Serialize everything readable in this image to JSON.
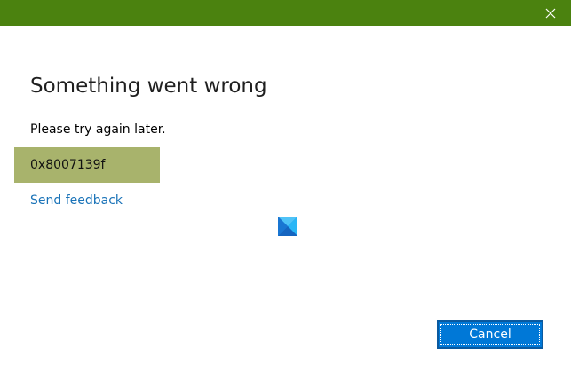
{
  "titlebar": {
    "close_icon": "close-icon",
    "color": "#4b820f"
  },
  "dialog": {
    "title": "Something went wrong",
    "message": "Please try again later.",
    "error_code": "0x8007139f",
    "error_box_color": "#a8b36c",
    "feedback_link": "Send feedback",
    "logo_icon": "windows-logo-icon",
    "cancel_label": "Cancel",
    "accent_color": "#0078d7",
    "link_color": "#1a73b8"
  }
}
